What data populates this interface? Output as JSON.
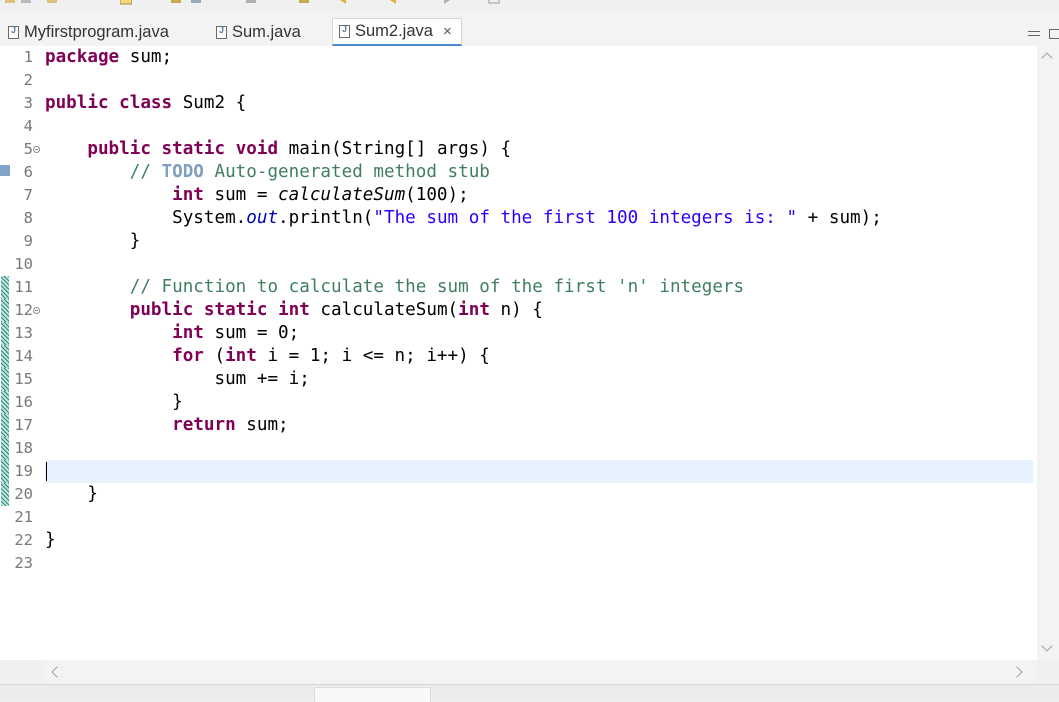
{
  "tabs": [
    {
      "label": "Myfirstprogram.java",
      "active": false
    },
    {
      "label": "Sum.java",
      "active": false
    },
    {
      "label": "Sum2.java",
      "active": true
    }
  ],
  "tab_close_glyph": "×",
  "editor": {
    "current_line": 19,
    "lines": [
      {
        "n": "1",
        "text": "package sum;"
      },
      {
        "n": "2",
        "text": ""
      },
      {
        "n": "3",
        "text": "public class Sum2 {"
      },
      {
        "n": "4",
        "text": ""
      },
      {
        "n": "5",
        "text": "    public static void main(String[] args) {"
      },
      {
        "n": "6",
        "text": "        // TODO Auto-generated method stub"
      },
      {
        "n": "7",
        "text": "            int sum = calculateSum(100);"
      },
      {
        "n": "8",
        "text": "            System.out.println(\"The sum of the first 100 integers is: \" + sum);"
      },
      {
        "n": "9",
        "text": "        }"
      },
      {
        "n": "10",
        "text": ""
      },
      {
        "n": "11",
        "text": "        // Function to calculate the sum of the first 'n' integers"
      },
      {
        "n": "12",
        "text": "        public static int calculateSum(int n) {"
      },
      {
        "n": "13",
        "text": "            int sum = 0;"
      },
      {
        "n": "14",
        "text": "            for (int i = 1; i <= n; i++) {"
      },
      {
        "n": "15",
        "text": "                sum += i;"
      },
      {
        "n": "16",
        "text": "            }"
      },
      {
        "n": "17",
        "text": "            return sum;"
      },
      {
        "n": "18",
        "text": ""
      },
      {
        "n": "19",
        "text": ""
      },
      {
        "n": "20",
        "text": "    }"
      },
      {
        "n": "21",
        "text": ""
      },
      {
        "n": "22",
        "text": "}"
      },
      {
        "n": "23",
        "text": ""
      }
    ]
  },
  "colors": {
    "keyword": "#7f0055",
    "comment": "#3f7f5f",
    "string": "#2a00ff",
    "field": "#0000c0",
    "current_line": "#e8f2fe",
    "active_tab_underline": "#4a88c8"
  },
  "icons": [
    "java-file-icon",
    "close-icon",
    "minimize-icon",
    "maximize-icon",
    "fold-toggle-icon",
    "warning-marker-icon",
    "scroll-up-icon",
    "scroll-down-icon",
    "scroll-left-icon",
    "scroll-right-icon"
  ]
}
